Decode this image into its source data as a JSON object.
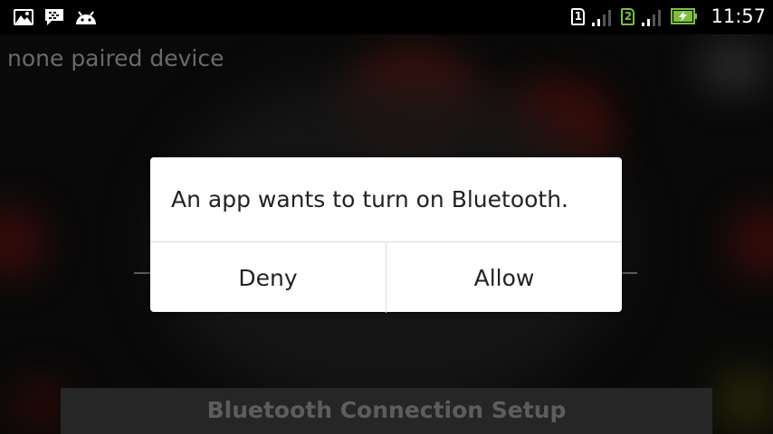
{
  "status_bar": {
    "time": "11:57",
    "sim1": "1",
    "sim2": "2",
    "icons": [
      "picture-icon",
      "bbm-chat-icon",
      "android-icon",
      "sim1-icon",
      "signal-icon",
      "sim2-icon",
      "signal-icon",
      "battery-charging-icon"
    ],
    "colors": {
      "battery_green": "#7fbf3f"
    }
  },
  "app": {
    "paired_status": "none paired device",
    "bottom_button": "Bluetooth Connection Setup"
  },
  "dialog": {
    "message": "An app wants to turn on Bluetooth.",
    "deny": "Deny",
    "allow": "Allow"
  }
}
